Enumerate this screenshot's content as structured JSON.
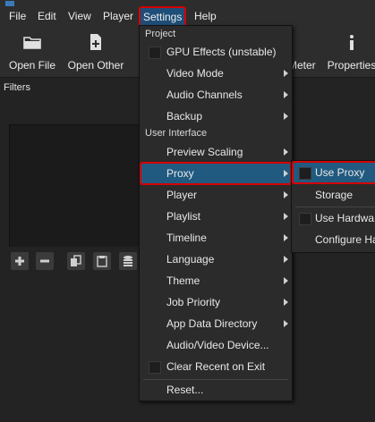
{
  "menubar": {
    "items": [
      "File",
      "Edit",
      "View",
      "Player",
      "Settings",
      "Help"
    ],
    "active_index": 4
  },
  "toolbar": {
    "open_file": "Open File",
    "open_other": "Open Other",
    "meter": "Meter",
    "properties": "Properties"
  },
  "filters": {
    "title": "Filters"
  },
  "settings_menu": {
    "section_project": "Project",
    "gpu_effects": "GPU Effects (unstable)",
    "video_mode": "Video Mode",
    "audio_channels": "Audio Channels",
    "backup": "Backup",
    "section_ui": "User Interface",
    "preview_scaling": "Preview Scaling",
    "proxy": "Proxy",
    "player": "Player",
    "playlist": "Playlist",
    "timeline": "Timeline",
    "language": "Language",
    "theme": "Theme",
    "job_priority": "Job Priority",
    "app_data_directory": "App Data Directory",
    "audio_video_device": "Audio/Video Device...",
    "clear_recent_on_exit": "Clear Recent on Exit",
    "reset": "Reset..."
  },
  "proxy_submenu": {
    "use_proxy": "Use Proxy",
    "storage": "Storage",
    "use_hardware": "Use Hardwa",
    "configure_hardware": "Configure Ha"
  },
  "colors": {
    "highlight": "#215a80",
    "annotation_red": "#d40000",
    "background": "#232323"
  }
}
